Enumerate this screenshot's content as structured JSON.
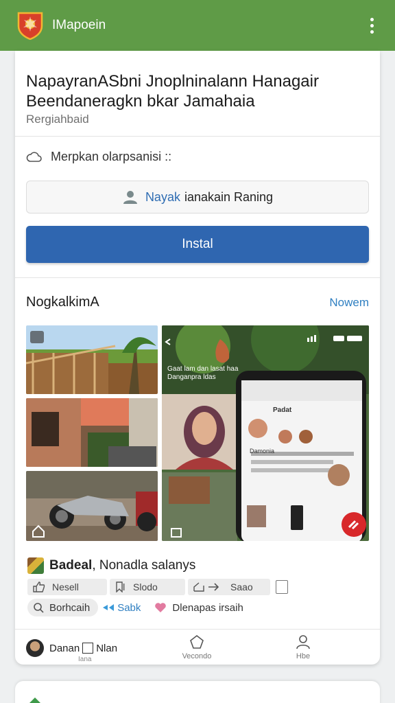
{
  "header": {
    "title": "IMapoein",
    "colors": {
      "bar": "#5f9b47",
      "logo_red": "#d8402a",
      "logo_gold": "#f2b632"
    }
  },
  "listing": {
    "headline_line1": "NapayranASbni Jnoplninalann Hanagair",
    "headline_line2": "Beendaneragkn bkar Jamahaia",
    "subtitle": "Rergiahbaid",
    "meta_text": "Merpkan olarpsanisi ::",
    "info_accent": "Nayak",
    "info_text": "ianakain Raning",
    "install_label": "Instal"
  },
  "screenshots": {
    "title": "NogkalkimA",
    "link": "Nowem",
    "phone_header": "Padat",
    "phone_text": "Damonia",
    "overlay_text_1": "Gaat lam dan lasat haa",
    "overlay_text_2": "Danganpra ldas"
  },
  "app_info": {
    "name_bold": "Badeal",
    "name_rest": ", Nonadla salanys"
  },
  "actions": [
    {
      "label": "Nesell",
      "icon": "thumb-up-icon"
    },
    {
      "label": "Slodo",
      "icon": "bookmark-icon"
    },
    {
      "label": "Saao",
      "icon": "share-icon"
    }
  ],
  "tags": [
    {
      "label": "Borhcaih",
      "icon": "search-icon"
    },
    {
      "label": "Sabk",
      "icon": "sparkle-icon"
    },
    {
      "label": "Dlenapas irsaih",
      "icon": "heart-icon"
    }
  ],
  "bottom_nav": {
    "left_text_a": "Danan",
    "left_text_b": "Nlan",
    "left_sub": "Iana",
    "center_label": "Vecondo",
    "right_label": "Hbe"
  }
}
